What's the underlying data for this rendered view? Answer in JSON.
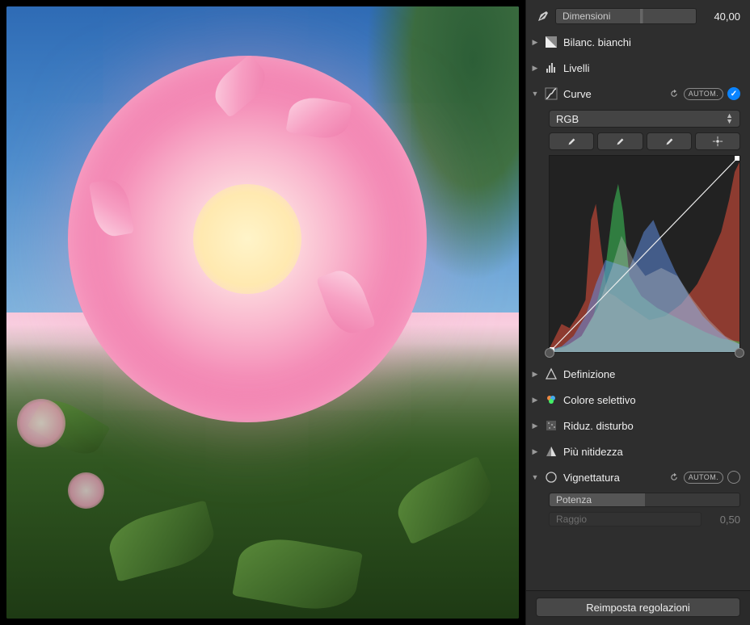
{
  "dimensions": {
    "label": "Dimensioni",
    "value": "40,00"
  },
  "adjustments": {
    "white_balance": {
      "label": "Bilanc. bianchi"
    },
    "levels": {
      "label": "Livelli"
    },
    "curves": {
      "label": "Curve",
      "auto_label": "AUTOM.",
      "channel": "RGB",
      "enabled": true
    },
    "definition": {
      "label": "Definizione"
    },
    "selective_color": {
      "label": "Colore selettivo"
    },
    "noise_reduction": {
      "label": "Riduz. disturbo"
    },
    "sharpen": {
      "label": "Più nitidezza"
    },
    "vignette": {
      "label": "Vignettatura",
      "auto_label": "AUTOM.",
      "enabled": false,
      "strength_label": "Potenza",
      "radius_label": "Raggio",
      "radius_value": "0,50"
    }
  },
  "footer": {
    "reset_label": "Reimposta regolazioni"
  }
}
